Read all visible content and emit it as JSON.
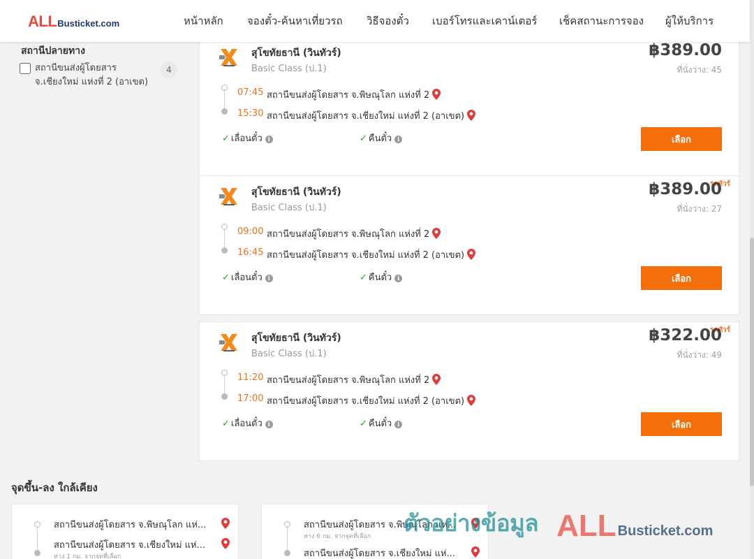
{
  "header": {
    "logo_prefix": "ALL",
    "logo_suffix": "Busticket.com",
    "nav": [
      "หน้าหลัก",
      "จองตั๋ว-ค้นหาเที่ยวรถ",
      "วิธีจองตั๋ว",
      "เบอร์โทรและเคาน์เตอร์",
      "เช็คสถานะการจอง",
      "ผู้ให้บริการ"
    ]
  },
  "filter": {
    "title": "สถานีปลายทาง",
    "option_label": "สถานีขนส่งผู้โดยสาร จ.เชียงใหม่ แห่งที่ 2 (อาเขต)",
    "option_count": "4",
    "option_checked": false
  },
  "trips": [
    {
      "tag": "",
      "operator": "สุโขทัยธานี (วินทัวร์)",
      "class": "Basic Class (ป.1)",
      "price": "฿389.00",
      "seats": "ที่นั่งว่าง: 45",
      "depart_time": "07:45",
      "depart_station": "สถานีขนส่งผู้โดยสาร จ.พิษณุโลก แห่งที่ 2",
      "arrive_time": "15:30",
      "arrive_station": "สถานีขนส่งผู้โดยสาร จ.เชียงใหม่ แห่งที่ 2 (อาเขต)",
      "feature_1": "เลื่อนตั๋ว",
      "feature_2": "คืนตั๋ว",
      "button": "เลือก"
    },
    {
      "tag": "รถทัวร์",
      "operator": "สุโขทัยธานี (วินทัวร์)",
      "class": "Basic Class (ป.1)",
      "price": "฿389.00",
      "seats": "ที่นั่งว่าง: 27",
      "depart_time": "09:00",
      "depart_station": "สถานีขนส่งผู้โดยสาร จ.พิษณุโลก แห่งที่ 2",
      "arrive_time": "16:45",
      "arrive_station": "สถานีขนส่งผู้โดยสาร จ.เชียงใหม่ แห่งที่ 2 (อาเขต)",
      "feature_1": "เลื่อนตั๋ว",
      "feature_2": "คืนตั๋ว",
      "button": "เลือก"
    },
    {
      "tag": "รถทัวร์",
      "operator": "สุโขทัยธานี (วินทัวร์)",
      "class": "Basic Class (ป.1)",
      "price": "฿322.00",
      "seats": "ที่นั่งว่าง: 49",
      "depart_time": "11:20",
      "depart_station": "สถานีขนส่งผู้โดยสาร จ.พิษณุโลก แห่งที่ 2",
      "arrive_time": "17:00",
      "arrive_station": "สถานีขนส่งผู้โดยสาร จ.เชียงใหม่ แห่งที่ 2 (อาเขต)",
      "feature_1": "เลื่อนตั๋ว",
      "feature_2": "คืนตั๋ว",
      "button": "เลือก"
    }
  ],
  "nearby": {
    "title": "จุดขึ้น-ลง ใกล้เคียง",
    "cards": [
      {
        "from": "สถานีขนส่งผู้โดยสาร จ.พิษณุโลก แห่...",
        "from_dist": "",
        "to": "สถานีขนส่งผู้โดยสาร จ.เชียงใหม่ แห่...",
        "to_dist": "ห่าง 1 กม. จากจุดที่เลือก"
      },
      {
        "from": "สถานีขนส่งผู้โดยสาร จ.พิษณุโลก แห่...",
        "from_dist": "ห่าง 6 กม. จากจุดที่เลือก",
        "to": "สถานีขนส่งผู้โดยสาร จ.เชียงใหม่ แห่...",
        "to_dist": ""
      }
    ]
  },
  "watermark": {
    "text": "ตัวอย่างข้อมูล",
    "brand_prefix": "ALL",
    "brand_suffix": "Busticket.com"
  },
  "colors": {
    "accent": "#f46f0a",
    "time": "#e8731c",
    "pin": "#e03a3a",
    "check": "#2e9e2e",
    "logo_red": "#e84a3c",
    "logo_navy": "#1a3a6b"
  },
  "icons": {
    "pin": "map-pin-icon",
    "check": "check-icon",
    "info": "info-icon",
    "checkbox": "checkbox-icon"
  }
}
